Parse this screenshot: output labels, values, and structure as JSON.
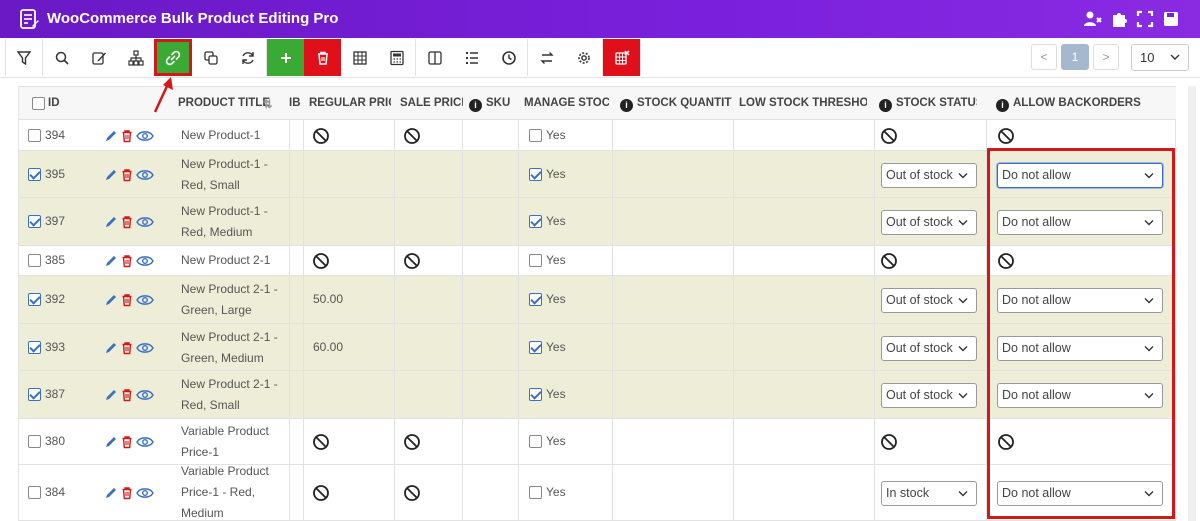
{
  "app": {
    "title": "WooCommerce Bulk Product Editing Pro"
  },
  "header_icons": [
    "user-settings-icon",
    "puzzle-icon",
    "fullscreen-icon",
    "save-icon"
  ],
  "toolbar": {
    "buttons": [
      "filter-icon",
      "search-icon",
      "edit-icon",
      "hierarchy-icon",
      "link-icon",
      "duplicate-icon",
      "refresh-icon",
      "plus-icon",
      "trash-icon",
      "table-icon",
      "calculator-icon",
      "columns-icon",
      "list-icon",
      "history-icon",
      "swap-icon",
      "gear-icon",
      "delete-grid-icon"
    ]
  },
  "pagination": {
    "prev": "<",
    "current": "1",
    "next": ">",
    "per_page": "10"
  },
  "columns": {
    "id": "ID",
    "title": "PRODUCT TITLE",
    "ib": "IB",
    "regular_price": "REGULAR PRICE",
    "sale_price": "SALE PRICE",
    "sku": "SKU",
    "manage_stock": "MANAGE STOCK",
    "stock_quantity": "STOCK QUANTITY",
    "low_stock": "LOW STOCK THRESHOLD",
    "stock_status": "STOCK STATUS",
    "allow_backorders": "ALLOW BACKORDERS"
  },
  "rows": [
    {
      "id": "394",
      "checked": false,
      "title_l1": "New Product-1",
      "title_l2": "",
      "regular_price": "",
      "sale_price": "",
      "manage": "Yes",
      "manage_checked": false,
      "stock_status": "",
      "backorders": ""
    },
    {
      "id": "395",
      "checked": true,
      "title_l1": "New Product-1 -",
      "title_l2": "Red, Small",
      "regular_price": "",
      "sale_price": "",
      "manage": "Yes",
      "manage_checked": true,
      "stock_status": "Out of stock",
      "backorders": "Do not allow"
    },
    {
      "id": "397",
      "checked": true,
      "title_l1": "New Product-1 -",
      "title_l2": "Red, Medium",
      "regular_price": "",
      "sale_price": "",
      "manage": "Yes",
      "manage_checked": true,
      "stock_status": "Out of stock",
      "backorders": "Do not allow"
    },
    {
      "id": "385",
      "checked": false,
      "title_l1": "New Product 2-1",
      "title_l2": "",
      "regular_price": "",
      "sale_price": "",
      "manage": "Yes",
      "manage_checked": false,
      "stock_status": "",
      "backorders": ""
    },
    {
      "id": "392",
      "checked": true,
      "title_l1": "New Product 2-1 -",
      "title_l2": "Green, Large",
      "regular_price": "50.00",
      "sale_price": "",
      "manage": "Yes",
      "manage_checked": true,
      "stock_status": "Out of stock",
      "backorders": "Do not allow"
    },
    {
      "id": "393",
      "checked": true,
      "title_l1": "New Product 2-1 -",
      "title_l2": "Green, Medium",
      "regular_price": "60.00",
      "sale_price": "",
      "manage": "Yes",
      "manage_checked": true,
      "stock_status": "Out of stock",
      "backorders": "Do not allow"
    },
    {
      "id": "387",
      "checked": true,
      "title_l1": "New Product 2-1 -",
      "title_l2": "Red, Small",
      "regular_price": "",
      "sale_price": "",
      "manage": "Yes",
      "manage_checked": true,
      "stock_status": "Out of stock",
      "backorders": "Do not allow"
    },
    {
      "id": "380",
      "checked": false,
      "title_l1": "Variable Product",
      "title_l2": "Price-1",
      "regular_price": "",
      "sale_price": "",
      "manage": "Yes",
      "manage_checked": false,
      "stock_status": "",
      "backorders": ""
    },
    {
      "id": "384",
      "checked": false,
      "title_l1": "Variable Product",
      "title_l2": "Price-1 - Red,",
      "title_l3": "Medium",
      "regular_price": "",
      "sale_price": "",
      "manage": "Yes",
      "manage_checked": false,
      "stock_status": "In stock",
      "backorders": "Do not allow"
    }
  ],
  "colors": {
    "header_purple": "#7a20dd",
    "selected_row": "#eeeed8",
    "green_btn": "#3aaa35",
    "red_btn": "#e0101a",
    "annotation_red": "#d21818"
  }
}
